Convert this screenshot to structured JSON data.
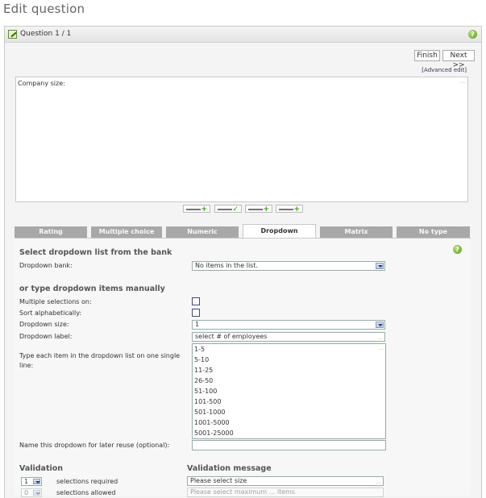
{
  "page": {
    "title": "Edit question"
  },
  "panel": {
    "title": "Question 1 / 1",
    "help": "?"
  },
  "toolbar": {
    "finish_label": "Finish",
    "next_label": "Next >>",
    "advanced_edit": "[Advanced edit]"
  },
  "editor": {
    "text": "Company size:",
    "dots": "…"
  },
  "tabs": [
    "Rating",
    "Multiple choice",
    "Numeric",
    "Dropdown",
    "Matrix",
    "No type"
  ],
  "dropdown_tab": {
    "help": "?",
    "bank_section_title": "Select dropdown list from the bank",
    "bank_label": "Dropdown bank:",
    "bank_value": "No items in the list.",
    "manual_section_title": "or type dropdown items manually",
    "multiple_label": "Multiple selections on:",
    "sort_label": "Sort alphabetically:",
    "size_label": "Dropdown size:",
    "size_value": "1",
    "dd_label_label": "Dropdown label:",
    "dd_label_value": "select # of employees",
    "items_label": "Type each item in the dropdown list on one single line:",
    "items": [
      "1-5",
      "5-10",
      "11-25",
      "26-50",
      "51-100",
      "101-500",
      "501-1000",
      "1001-5000",
      "5001-25000"
    ],
    "name_label": "Name this dropdown for later reuse (optional):",
    "name_value": "",
    "validation_title": "Validation",
    "validation_message_title": "Validation message",
    "required_value": "1",
    "required_label": "selections required",
    "required_message": "Please select size",
    "allowed_value": "0",
    "allowed_label": "selections allowed",
    "allowed_message": "Please select maximum ... items"
  }
}
